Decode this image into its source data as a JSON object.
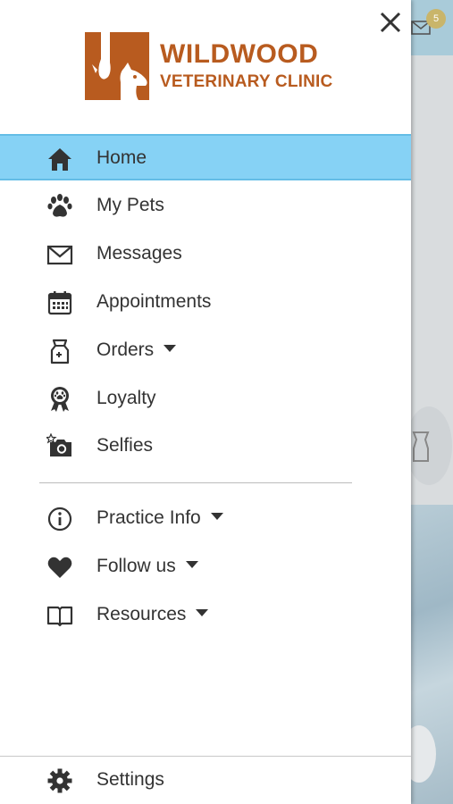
{
  "logo": {
    "name": "WILDWOOD",
    "subtitle": "VETERINARY CLINIC"
  },
  "menu": {
    "home": "Home",
    "my_pets": "My Pets",
    "messages": "Messages",
    "appointments": "Appointments",
    "orders": "Orders",
    "loyalty": "Loyalty",
    "selfies": "Selfies",
    "practice_info": "Practice Info",
    "follow_us": "Follow us",
    "resources": "Resources",
    "settings": "Settings"
  },
  "background": {
    "notification_count": "5"
  },
  "colors": {
    "brand": "#b85b1f",
    "active_item": "#86d2f5",
    "text": "#333333"
  }
}
